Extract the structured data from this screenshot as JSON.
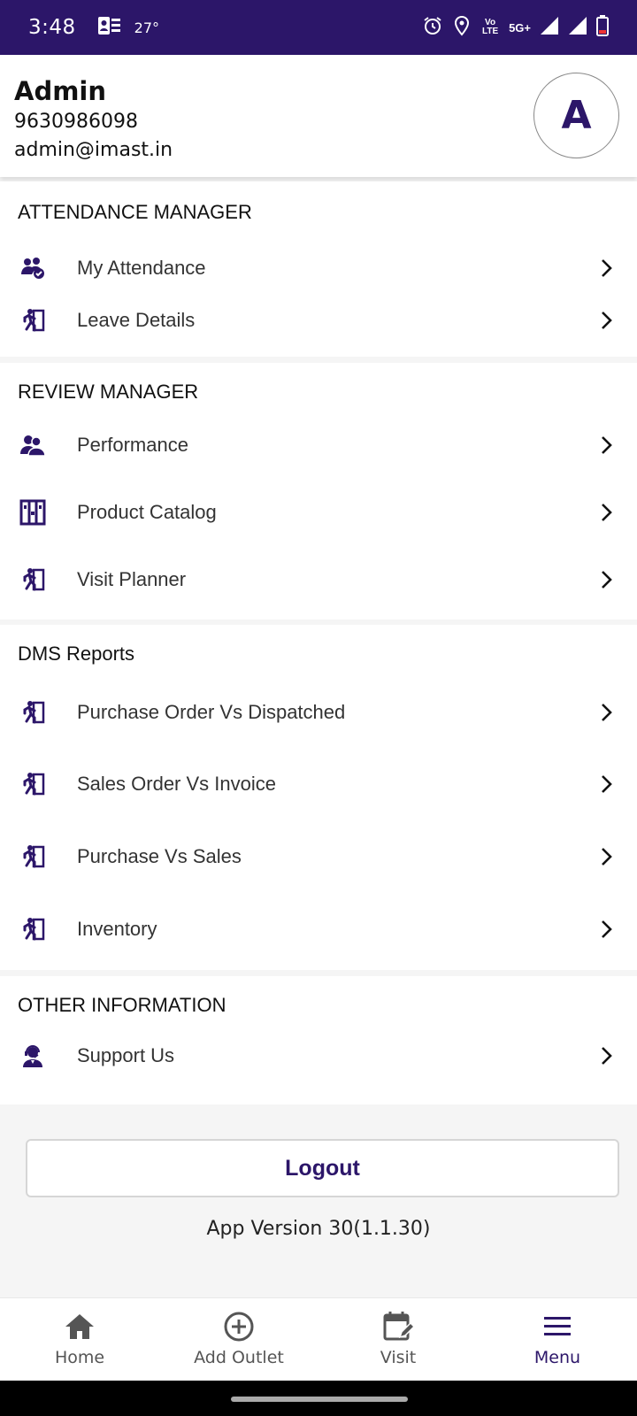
{
  "status_bar": {
    "time": "3:48",
    "temperature": "27°",
    "volte": "Vo LTE",
    "network": "5G+"
  },
  "profile": {
    "name": "Admin",
    "phone": "9630986098",
    "email": "admin@imast.in",
    "avatar_letter": "A"
  },
  "sections": {
    "attendance": {
      "title": "ATTENDANCE MANAGER",
      "items": [
        {
          "label": "My Attendance",
          "icon": "group-check-icon"
        },
        {
          "label": "Leave Details",
          "icon": "running-person-icon"
        }
      ]
    },
    "review": {
      "title": "REVIEW MANAGER",
      "items": [
        {
          "label": "Performance",
          "icon": "users-icon"
        },
        {
          "label": "Product Catalog",
          "icon": "catalog-icon"
        },
        {
          "label": "Visit Planner",
          "icon": "running-person-icon"
        }
      ]
    },
    "dms": {
      "title": "DMS Reports",
      "items": [
        {
          "label": "Purchase Order Vs Dispatched",
          "icon": "running-person-icon"
        },
        {
          "label": "Sales Order Vs Invoice",
          "icon": "running-person-icon"
        },
        {
          "label": "Purchase Vs Sales",
          "icon": "running-person-icon"
        },
        {
          "label": "Inventory",
          "icon": "running-person-icon"
        }
      ]
    },
    "other": {
      "title": "OTHER INFORMATION",
      "items": [
        {
          "label": "Support Us",
          "icon": "support-agent-icon"
        }
      ]
    }
  },
  "logout_label": "Logout",
  "app_version": "App Version 30(1.1.30)",
  "bottom_nav": [
    {
      "label": "Home",
      "icon": "home-icon",
      "active": false
    },
    {
      "label": "Add Outlet",
      "icon": "add-circle-icon",
      "active": false
    },
    {
      "label": "Visit",
      "icon": "calendar-edit-icon",
      "active": false
    },
    {
      "label": "Menu",
      "icon": "menu-icon",
      "active": true
    }
  ],
  "colors": {
    "primary": "#2c1669",
    "background": "#f5f5f5",
    "text": "#333333"
  }
}
